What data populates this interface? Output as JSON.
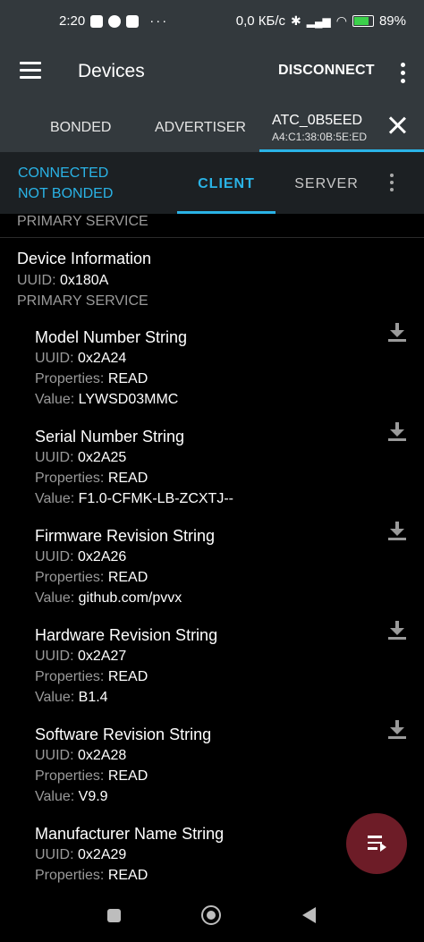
{
  "status_bar": {
    "time": "2:20",
    "dots": "···",
    "network_speed": "0,0 КБ/с",
    "battery": "89%"
  },
  "app_bar": {
    "title": "Devices",
    "disconnect_label": "DISCONNECT"
  },
  "tabs": {
    "bonded": "BONDED",
    "advertiser": "ADVERTISER",
    "device_name": "ATC_0B5EED",
    "device_address": "A4:C1:38:0B:5E:ED"
  },
  "sub_bar": {
    "connected": "CONNECTED",
    "bond_state": "NOT BONDED",
    "client_tab": "CLIENT",
    "server_tab": "SERVER"
  },
  "content": {
    "top_label": "PRIMARY SERVICE",
    "service": {
      "name": "Device Information",
      "uuid_label": "UUID:",
      "uuid": "0x180A",
      "type": "PRIMARY SERVICE"
    },
    "labels": {
      "uuid": "UUID:",
      "properties": "Properties:",
      "value": "Value:"
    },
    "characteristics": [
      {
        "name": "Model Number String",
        "uuid": "0x2A24",
        "properties": "READ",
        "value": "LYWSD03MMC"
      },
      {
        "name": "Serial Number String",
        "uuid": "0x2A25",
        "properties": "READ",
        "value": "F1.0-CFMK-LB-ZCXTJ--"
      },
      {
        "name": "Firmware Revision String",
        "uuid": "0x2A26",
        "properties": "READ",
        "value": "github.com/pvvx"
      },
      {
        "name": "Hardware Revision String",
        "uuid": "0x2A27",
        "properties": "READ",
        "value": "B1.4"
      },
      {
        "name": "Software Revision String",
        "uuid": "0x2A28",
        "properties": "READ",
        "value": "V9.9"
      },
      {
        "name": "Manufacturer Name String",
        "uuid": "0x2A29",
        "properties": "READ"
      }
    ]
  },
  "colors": {
    "accent": "#2ab3e6",
    "toolbar": "#33393d",
    "fab": "#6d1c27"
  }
}
